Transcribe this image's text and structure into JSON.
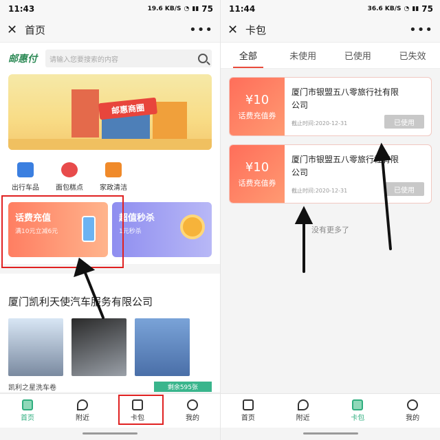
{
  "left": {
    "status": {
      "time": "11:43",
      "speed": "19.6 KB/S",
      "battery": "75"
    },
    "nav": {
      "title": "首页"
    },
    "search": {
      "logo": "邮惠付",
      "placeholder": "请输入您要搜索的内容"
    },
    "banner": {
      "sign": "邮惠商圈"
    },
    "icons": [
      {
        "label": "出行车品",
        "color": "#3b7fe0"
      },
      {
        "label": "面包糕点",
        "color": "#e84b4b"
      },
      {
        "label": "家政清洁",
        "color": "#f08a2a"
      }
    ],
    "promos": {
      "recharge": {
        "title": "话费充值",
        "subtitle": "满10元立减6元"
      },
      "seckill": {
        "title": "超值秒杀",
        "subtitle": "1元秒杀"
      }
    },
    "company": {
      "title": "厦门凯利天使汽车服务有限公司",
      "shop_tag": "凯利之星洗车卷",
      "stock": "剩余595张"
    },
    "tabs": [
      {
        "label": "首页",
        "active": true
      },
      {
        "label": "附近",
        "active": false
      },
      {
        "label": "卡包",
        "active": false
      },
      {
        "label": "我的",
        "active": false
      }
    ]
  },
  "right": {
    "status": {
      "time": "11:44",
      "speed": "36.6 KB/S",
      "battery": "75"
    },
    "nav": {
      "title": "卡包"
    },
    "filters": [
      {
        "label": "全部",
        "active": true
      },
      {
        "label": "未使用",
        "active": false
      },
      {
        "label": "已使用",
        "active": false
      },
      {
        "label": "已失效",
        "active": false
      }
    ],
    "coupons": [
      {
        "amount": "¥10",
        "kind": "话费充值券",
        "merchant": "厦门市银盟五八零旅行社有限公司",
        "expiry": "截止时间:2020-12-31",
        "status": "已使用"
      },
      {
        "amount": "¥10",
        "kind": "话费充值券",
        "merchant": "厦门市银盟五八零旅行社有限公司",
        "expiry": "截止时间:2020-12-31",
        "status": "已使用"
      }
    ],
    "no_more": "没有更多了",
    "tabs": [
      {
        "label": "首页",
        "active": false
      },
      {
        "label": "附近",
        "active": false
      },
      {
        "label": "卡包",
        "active": true
      },
      {
        "label": "我的",
        "active": false
      }
    ]
  },
  "colors": {
    "accent_green": "#2fae7f",
    "coupon_red": "#ff6e5a",
    "annotation_red": "#e02020"
  }
}
